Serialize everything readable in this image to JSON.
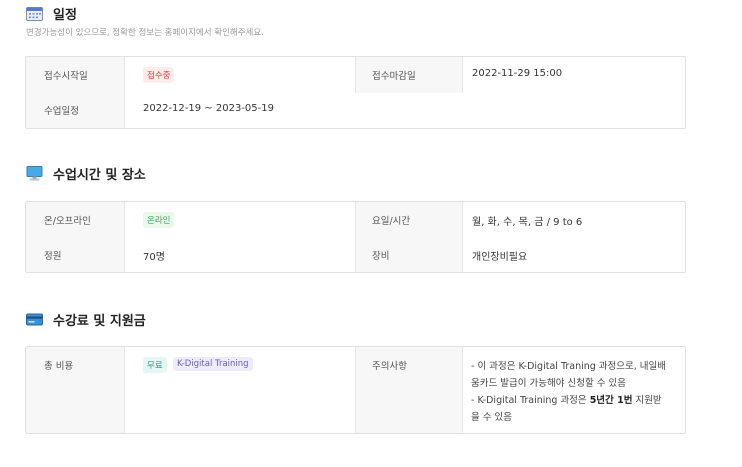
{
  "schedule": {
    "title": "일정",
    "subnote": "변경가능성이 있으므로, 정확한 정보는 홈페이지에서 확인해주세요.",
    "rows": [
      {
        "label": "접수시작일",
        "badge": "접수중",
        "label2": "접수마감일",
        "value2": "2022-11-29 15:00"
      },
      {
        "label": "수업일정",
        "value": "2022-12-19 ~ 2023-05-19"
      }
    ]
  },
  "class_info": {
    "title": "수업시간 및 장소",
    "rows": [
      {
        "label": "온/오프라인",
        "badge": "온라인",
        "label2": "요일/시간",
        "value2": "월, 화, 수, 목, 금 / 9 to 6"
      },
      {
        "label": "정원",
        "value": "70명",
        "label2": "장비",
        "value2": "개인장비필요"
      }
    ]
  },
  "fee": {
    "title": "수강료 및 지원금",
    "label": "총 비용",
    "badges": [
      "무료",
      "K-Digital Training"
    ],
    "label2": "주의사항",
    "note_line1": "- 이 과정은 K-Digital Traning 과정으로, 내일배",
    "note_line2": "움카드 발급이 가능해야 신청할 수 있음",
    "note_line3_prefix": "- K-Digital Training 과정은 ",
    "note_line3_bold": "5년간 1번",
    "note_line3_suffix": " 지원받",
    "note_line4": "을 수 있음"
  },
  "colors": {
    "badge_red": "#e0463a",
    "badge_green": "#3aa85a",
    "badge_teal": "#2a9d8a",
    "badge_purple": "#6a59c9"
  }
}
